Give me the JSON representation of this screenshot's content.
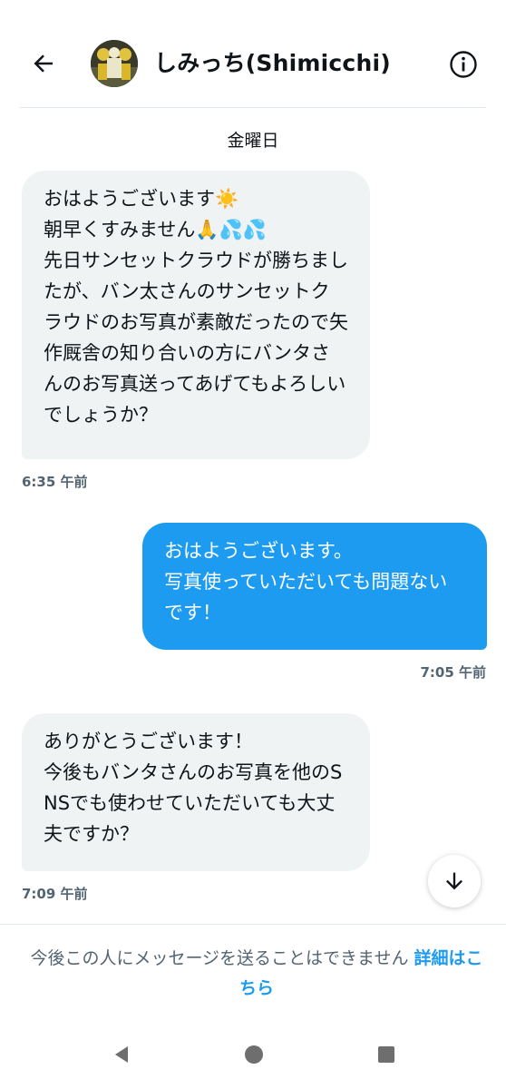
{
  "header": {
    "title": "しみっち(Shimicchi)",
    "back_icon": "arrow-left-icon",
    "info_icon": "info-circle-icon"
  },
  "date_separator": "金曜日",
  "messages": [
    {
      "direction": "received",
      "text": "おはようございます☀️\n朝早くすみません🙏💦💦\n先日サンセットクラウドが勝ちましたが、バン太さんのサンセットクラウドのお写真が素敵だったので矢作厩舎の知り合いの方にバンタさんのお写真送ってあげてもよろしいでしょうか？",
      "time": "6:35 午前"
    },
    {
      "direction": "sent",
      "text": "おはようございます。\n写真使っていただいても問題ないです！",
      "time": "7:05 午前"
    },
    {
      "direction": "received",
      "text": "ありがとうございます！\n今後もバンタさんのお写真を他のSNSでも使わせていただいても大丈夫ですか？",
      "time": "7:09 午前"
    }
  ],
  "scroll_button_icon": "arrow-down-icon",
  "notice": {
    "text": "今後この人にメッセージを送ることはできません ",
    "link": "詳細はこちら"
  },
  "navbar": {
    "back_icon": "triangle-back-icon",
    "home_icon": "circle-home-icon",
    "recent_icon": "square-recent-icon"
  },
  "colors": {
    "accent": "#1d9bf0",
    "received_bubble": "#eff3f4",
    "secondary_text": "#536471",
    "nav_icon": "#6e6e6e"
  }
}
